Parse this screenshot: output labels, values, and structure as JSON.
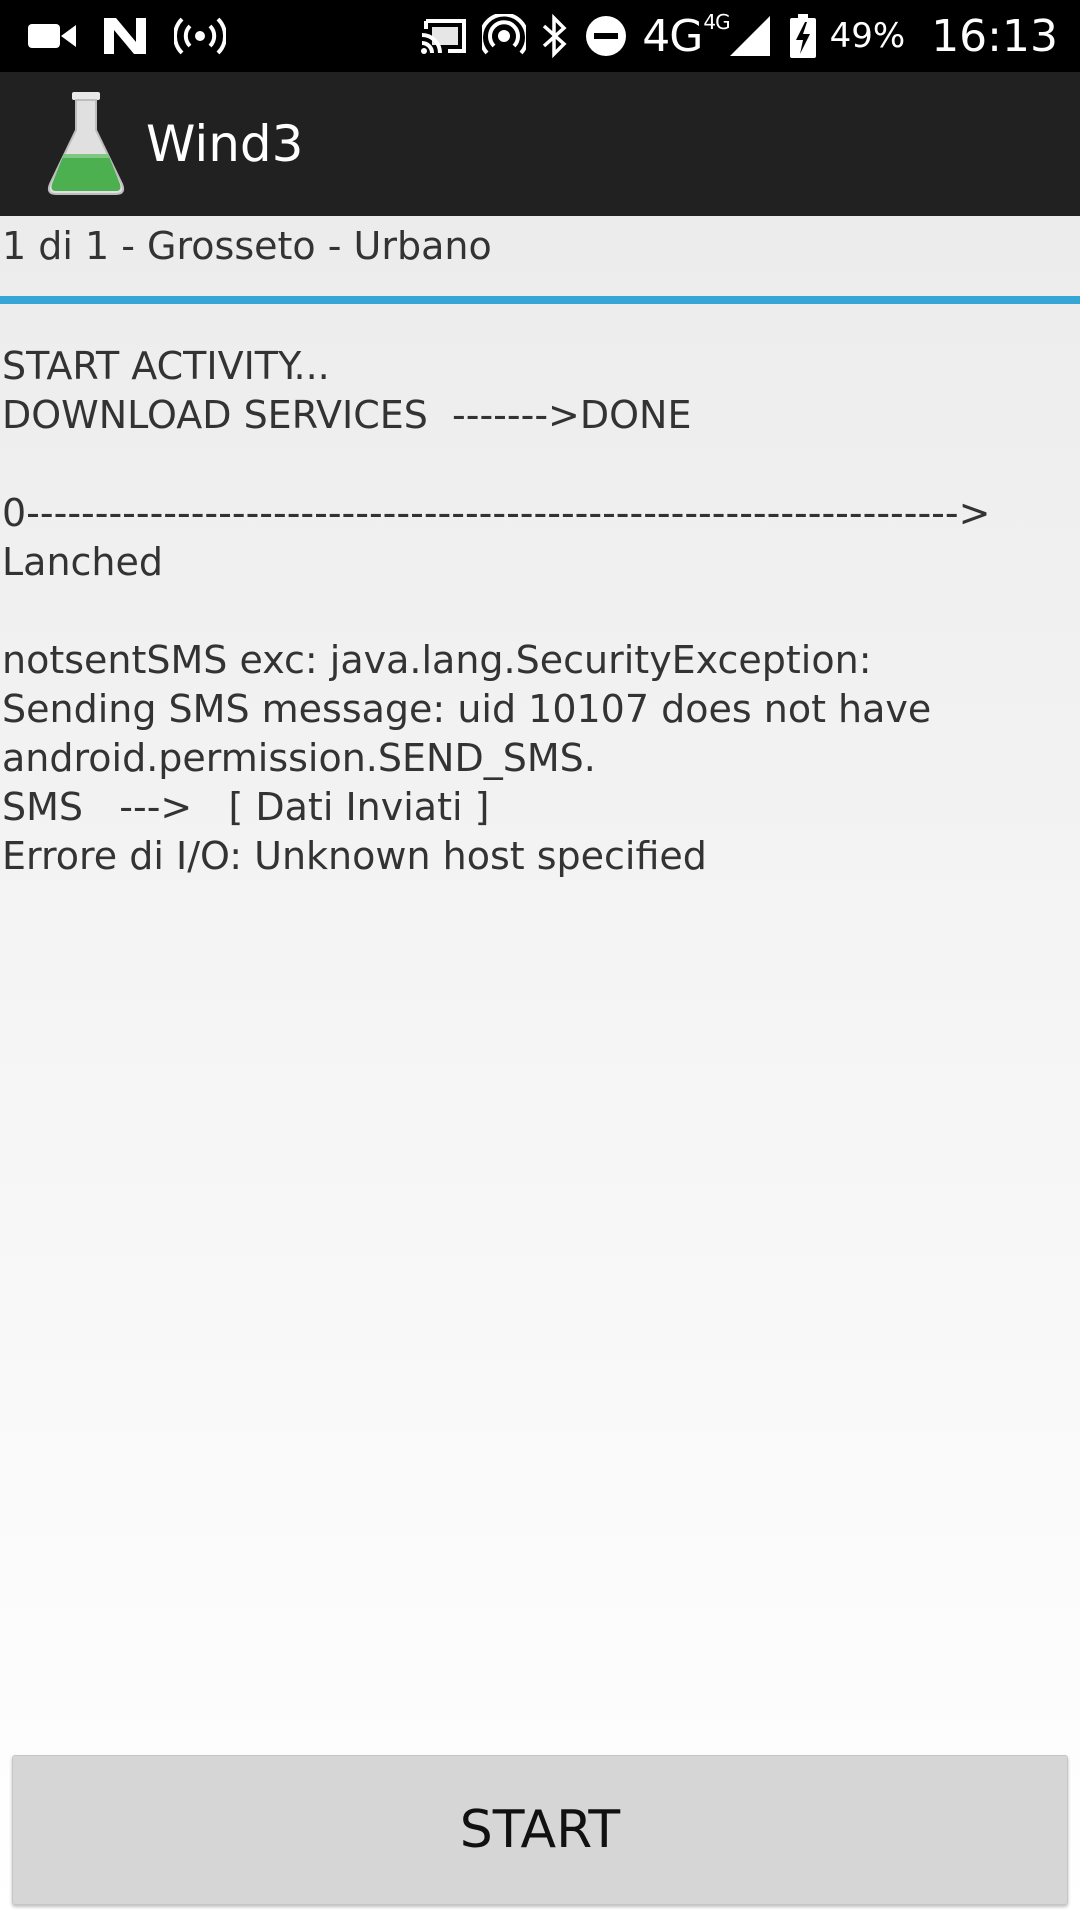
{
  "status_bar": {
    "network": "4G",
    "network_sup": "4G",
    "battery_percent": "49%",
    "time": "16:13",
    "icons": [
      "video-camera-icon",
      "n-notification-icon",
      "hotspot-icon",
      "cast-icon",
      "wifi-portable-icon",
      "bluetooth-icon",
      "do-not-disturb-icon",
      "signal-icon",
      "battery-charging-icon"
    ]
  },
  "app_bar": {
    "title": "Wind3",
    "logo_icon": "flask-icon",
    "logo_color": "#4caf50"
  },
  "header": {
    "text": "1 di 1 - Grosseto - Urbano"
  },
  "progress": {
    "value": 1.0,
    "color": "#35a6d6"
  },
  "log": {
    "text": "START ACTIVITY...\nDOWNLOAD SERVICES  ------->DONE\n\n0-------------------------------------------------------------------->\nLanched\n\nnotsentSMS exc: java.lang.SecurityException:\nSending SMS message: uid 10107 does not have\nandroid.permission.SEND_SMS.\nSMS   --->   [ Dati Inviati ]\nErrore di I/O: Unknown host specified"
  },
  "actions": {
    "start_label": "START"
  }
}
